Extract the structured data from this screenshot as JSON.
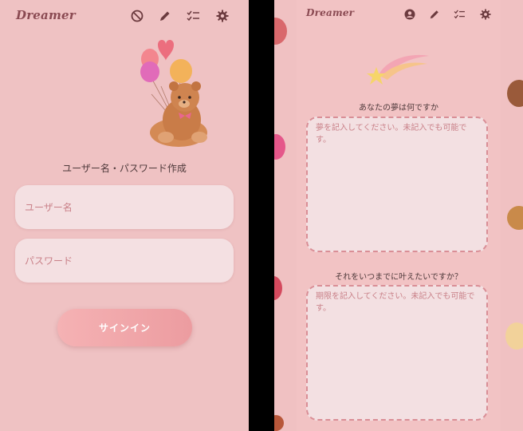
{
  "left_screen": {
    "logo": "Dreamer",
    "nav_icons": [
      "no-entry-icon",
      "pencil-icon",
      "checklist-icon",
      "gear-icon"
    ],
    "title": "ユーザー名・パスワード作成",
    "username_placeholder": "ユーザー名",
    "password_placeholder": "パスワード",
    "signin_label": "サインイン"
  },
  "right_screen": {
    "logo": "Dreamer",
    "nav_icons": [
      "account-icon",
      "pencil-icon",
      "checklist-icon",
      "gear-icon"
    ],
    "question1": "あなたの夢は何ですか",
    "dream_placeholder": "夢を記入してください。未記入でも可能です。",
    "question2": "それをいつまでに叶えたいですか？",
    "deadline_placeholder": "期限を記入してください。未記入でも可能です。"
  },
  "colors": {
    "background": "#efc2c3",
    "field": "#f4e0e2",
    "button": "#ec9ca0",
    "accent_text": "#8a4a52"
  }
}
